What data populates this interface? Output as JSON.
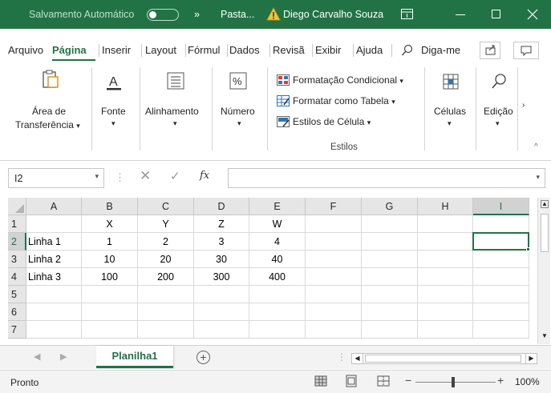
{
  "titlebar": {
    "autosave_label": "Salvamento Automático",
    "more_glyph": "»",
    "doc_name": "Pasta...",
    "user_name": "Diego Carvalho Souza"
  },
  "tabs": [
    "Arquivo",
    "Página",
    "Inserir",
    "Layout",
    "Fórmul",
    "Dados",
    "Revisã",
    "Exibir",
    "Ajuda"
  ],
  "tell_me": "Diga-me",
  "ribbon": {
    "clipboard_l1": "Área de",
    "clipboard_l2": "Transferência",
    "font": "Fonte",
    "alignment": "Alinhamento",
    "number": "Número",
    "cond_format": "Formatação Condicional",
    "format_table": "Formatar como Tabela",
    "cell_styles": "Estilos de Célula",
    "styles_caption": "Estilos",
    "cells": "Células",
    "editing": "Edição",
    "dropdown_glyph": "▾",
    "more_glyph": "›",
    "collapse_glyph": "^"
  },
  "formula_bar": {
    "name_box": "I2",
    "fx": "fx",
    "formula": "",
    "cancel_glyph": "✕",
    "enter_glyph": "✓"
  },
  "grid": {
    "columns": [
      "A",
      "B",
      "C",
      "D",
      "E",
      "F",
      "G",
      "H",
      "I"
    ],
    "rows": [
      "1",
      "2",
      "3",
      "4",
      "5",
      "6",
      "7"
    ],
    "cells": [
      [
        "",
        "X",
        "Y",
        "Z",
        "W",
        "",
        "",
        "",
        ""
      ],
      [
        "Linha 1",
        "1",
        "2",
        "3",
        "4",
        "",
        "",
        "",
        ""
      ],
      [
        "Linha 2",
        "10",
        "20",
        "30",
        "40",
        "",
        "",
        "",
        ""
      ],
      [
        "Linha 3",
        "100",
        "200",
        "300",
        "400",
        "",
        "",
        "",
        ""
      ],
      [
        "",
        "",
        "",
        "",
        "",
        "",
        "",
        "",
        ""
      ],
      [
        "",
        "",
        "",
        "",
        "",
        "",
        "",
        "",
        ""
      ],
      [
        "",
        "",
        "",
        "",
        "",
        "",
        "",
        "",
        ""
      ]
    ],
    "selected": "I2"
  },
  "sheets": {
    "active": "Planilha1",
    "add_glyph": "+"
  },
  "status": {
    "text": "Pronto",
    "zoom": "100%",
    "zoom_minus": "−",
    "zoom_plus": "+"
  },
  "colors": {
    "accent": "#217346"
  }
}
